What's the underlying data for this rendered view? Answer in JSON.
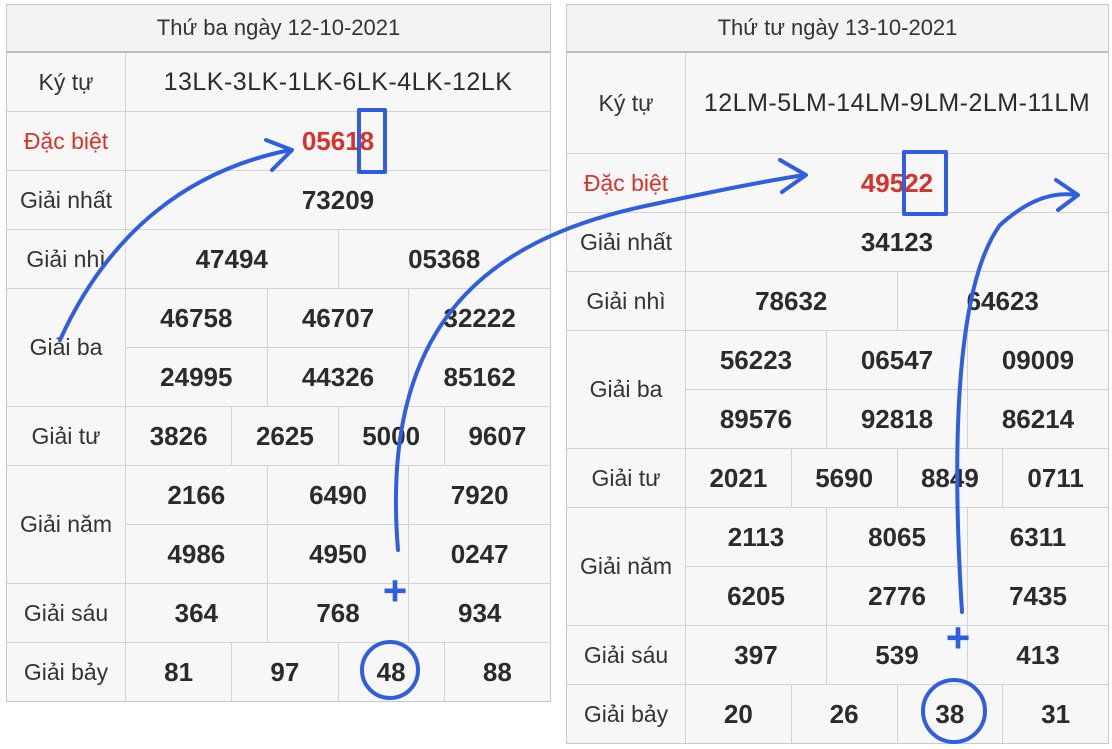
{
  "left": {
    "title": "Thứ ba ngày 12-10-2021",
    "rows": [
      {
        "label": "Ký tự",
        "lines": [
          [
            "13LK-3LK-1LK-6LK-4LK-12LK"
          ]
        ]
      },
      {
        "label": "Đặc biệt",
        "lines": [
          [
            "05618"
          ]
        ]
      },
      {
        "label": "Giải nhất",
        "lines": [
          [
            "73209"
          ]
        ]
      },
      {
        "label": "Giải nhì",
        "lines": [
          [
            "47494",
            "05368"
          ]
        ]
      },
      {
        "label": "Giải ba",
        "lines": [
          [
            "46758",
            "46707",
            "32222"
          ],
          [
            "24995",
            "44326",
            "85162"
          ]
        ]
      },
      {
        "label": "Giải tư",
        "lines": [
          [
            "3826",
            "2625",
            "5000",
            "9607"
          ]
        ]
      },
      {
        "label": "Giải năm",
        "lines": [
          [
            "2166",
            "6490",
            "7920"
          ],
          [
            "4986",
            "4950",
            "0247"
          ]
        ]
      },
      {
        "label": "Giải sáu",
        "lines": [
          [
            "364",
            "768",
            "934"
          ]
        ]
      },
      {
        "label": "Giải bảy",
        "lines": [
          [
            "81",
            "97",
            "48",
            "88"
          ]
        ]
      }
    ]
  },
  "right": {
    "title": "Thứ tư ngày 13-10-2021",
    "rows": [
      {
        "label": "Ký tự",
        "lines": [
          [
            "12LM-5LM-14LM-9LM-2LM-11LM"
          ]
        ]
      },
      {
        "label": "Đặc biệt",
        "lines": [
          [
            "49522"
          ]
        ]
      },
      {
        "label": "Giải nhất",
        "lines": [
          [
            "34123"
          ]
        ]
      },
      {
        "label": "Giải nhì",
        "lines": [
          [
            "78632",
            "64623"
          ]
        ]
      },
      {
        "label": "Giải ba",
        "lines": [
          [
            "56223",
            "06547",
            "09009"
          ],
          [
            "89576",
            "92818",
            "86214"
          ]
        ]
      },
      {
        "label": "Giải tư",
        "lines": [
          [
            "2021",
            "5690",
            "8849",
            "0711"
          ]
        ]
      },
      {
        "label": "Giải năm",
        "lines": [
          [
            "2113",
            "8065",
            "6311"
          ],
          [
            "6205",
            "2776",
            "7435"
          ]
        ]
      },
      {
        "label": "Giải sáu",
        "lines": [
          [
            "397",
            "539",
            "413"
          ]
        ]
      },
      {
        "label": "Giải bảy",
        "lines": [
          [
            "20",
            "26",
            "38",
            "31"
          ]
        ]
      }
    ]
  },
  "annotations": {
    "plus_symbol": "+",
    "color": "#2f5fe0",
    "circled_numbers": [
      "48",
      "38"
    ],
    "boxed_digits": [
      "8",
      "22"
    ]
  },
  "colors": {
    "special_prize": "#d7332a",
    "annotation": "#2f5fe0"
  }
}
